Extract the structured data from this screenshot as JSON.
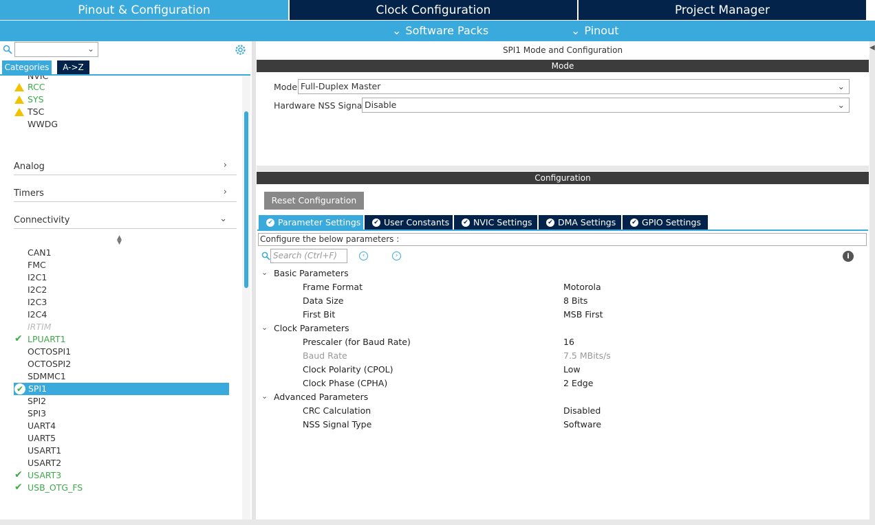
{
  "top_tabs": [
    "Pinout & Configuration",
    "Clock Configuration",
    "Project Manager"
  ],
  "sub_menu": [
    "Software Packs",
    "Pinout"
  ],
  "left": {
    "search_value": "",
    "category_tabs": [
      "Categories",
      "A->Z"
    ],
    "system_items": [
      {
        "label": "NVIC",
        "status": "none",
        "style": "normal"
      },
      {
        "label": "RCC",
        "status": "warning",
        "style": "green"
      },
      {
        "label": "SYS",
        "status": "warning",
        "style": "green"
      },
      {
        "label": "TSC",
        "status": "warning",
        "style": "normal"
      },
      {
        "label": "WWDG",
        "status": "none",
        "style": "normal"
      }
    ],
    "sections": [
      "Analog",
      "Timers",
      "Connectivity"
    ],
    "connectivity_items": [
      {
        "label": "CAN1",
        "status": "none",
        "style": "normal"
      },
      {
        "label": "FMC",
        "status": "none",
        "style": "normal"
      },
      {
        "label": "I2C1",
        "status": "none",
        "style": "normal"
      },
      {
        "label": "I2C2",
        "status": "none",
        "style": "normal"
      },
      {
        "label": "I2C3",
        "status": "none",
        "style": "normal"
      },
      {
        "label": "I2C4",
        "status": "none",
        "style": "normal"
      },
      {
        "label": "IRTIM",
        "status": "none",
        "style": "gray"
      },
      {
        "label": "LPUART1",
        "status": "check",
        "style": "green"
      },
      {
        "label": "OCTOSPI1",
        "status": "none",
        "style": "normal"
      },
      {
        "label": "OCTOSPI2",
        "status": "none",
        "style": "normal"
      },
      {
        "label": "SDMMC1",
        "status": "none",
        "style": "normal"
      },
      {
        "label": "SPI1",
        "status": "selected",
        "style": "selected"
      },
      {
        "label": "SPI2",
        "status": "none",
        "style": "normal"
      },
      {
        "label": "SPI3",
        "status": "none",
        "style": "normal"
      },
      {
        "label": "UART4",
        "status": "none",
        "style": "normal"
      },
      {
        "label": "UART5",
        "status": "none",
        "style": "normal"
      },
      {
        "label": "USART1",
        "status": "none",
        "style": "normal"
      },
      {
        "label": "USART2",
        "status": "none",
        "style": "normal"
      },
      {
        "label": "USART3",
        "status": "check",
        "style": "green"
      },
      {
        "label": "USB_OTG_FS",
        "status": "check",
        "style": "green"
      }
    ]
  },
  "right": {
    "title": "SPI1 Mode and Configuration",
    "mode_header": "Mode",
    "mode_label": "Mode",
    "mode_value": "Full-Duplex Master",
    "nss_label": "Hardware NSS Signal",
    "nss_value": "Disable",
    "config_header": "Configuration",
    "reset_button": "Reset Configuration",
    "config_tabs": [
      "Parameter Settings",
      "User Constants",
      "NVIC Settings",
      "DMA Settings",
      "GPIO Settings"
    ],
    "description": "Configure the below parameters :",
    "search_placeholder": "Search (Ctrl+F)",
    "groups": [
      {
        "name": "Basic Parameters",
        "params": [
          {
            "name": "Frame Format",
            "value": "Motorola",
            "dim": false
          },
          {
            "name": "Data Size",
            "value": "8 Bits",
            "dim": false
          },
          {
            "name": "First Bit",
            "value": "MSB First",
            "dim": false
          }
        ]
      },
      {
        "name": "Clock Parameters",
        "params": [
          {
            "name": "Prescaler (for Baud Rate)",
            "value": "16",
            "dim": false
          },
          {
            "name": "Baud Rate",
            "value": "7.5 MBits/s",
            "dim": true
          },
          {
            "name": "Clock Polarity (CPOL)",
            "value": "Low",
            "dim": false
          },
          {
            "name": "Clock Phase (CPHA)",
            "value": "2 Edge",
            "dim": false
          }
        ]
      },
      {
        "name": "Advanced Parameters",
        "params": [
          {
            "name": "CRC Calculation",
            "value": "Disabled",
            "dim": false
          },
          {
            "name": "NSS Signal Type",
            "value": "Software",
            "dim": false
          }
        ]
      }
    ]
  },
  "colors": {
    "accent": "#3aa9dc",
    "navy": "#03234b",
    "green": "#3daa49",
    "warning": "#f2c200"
  }
}
